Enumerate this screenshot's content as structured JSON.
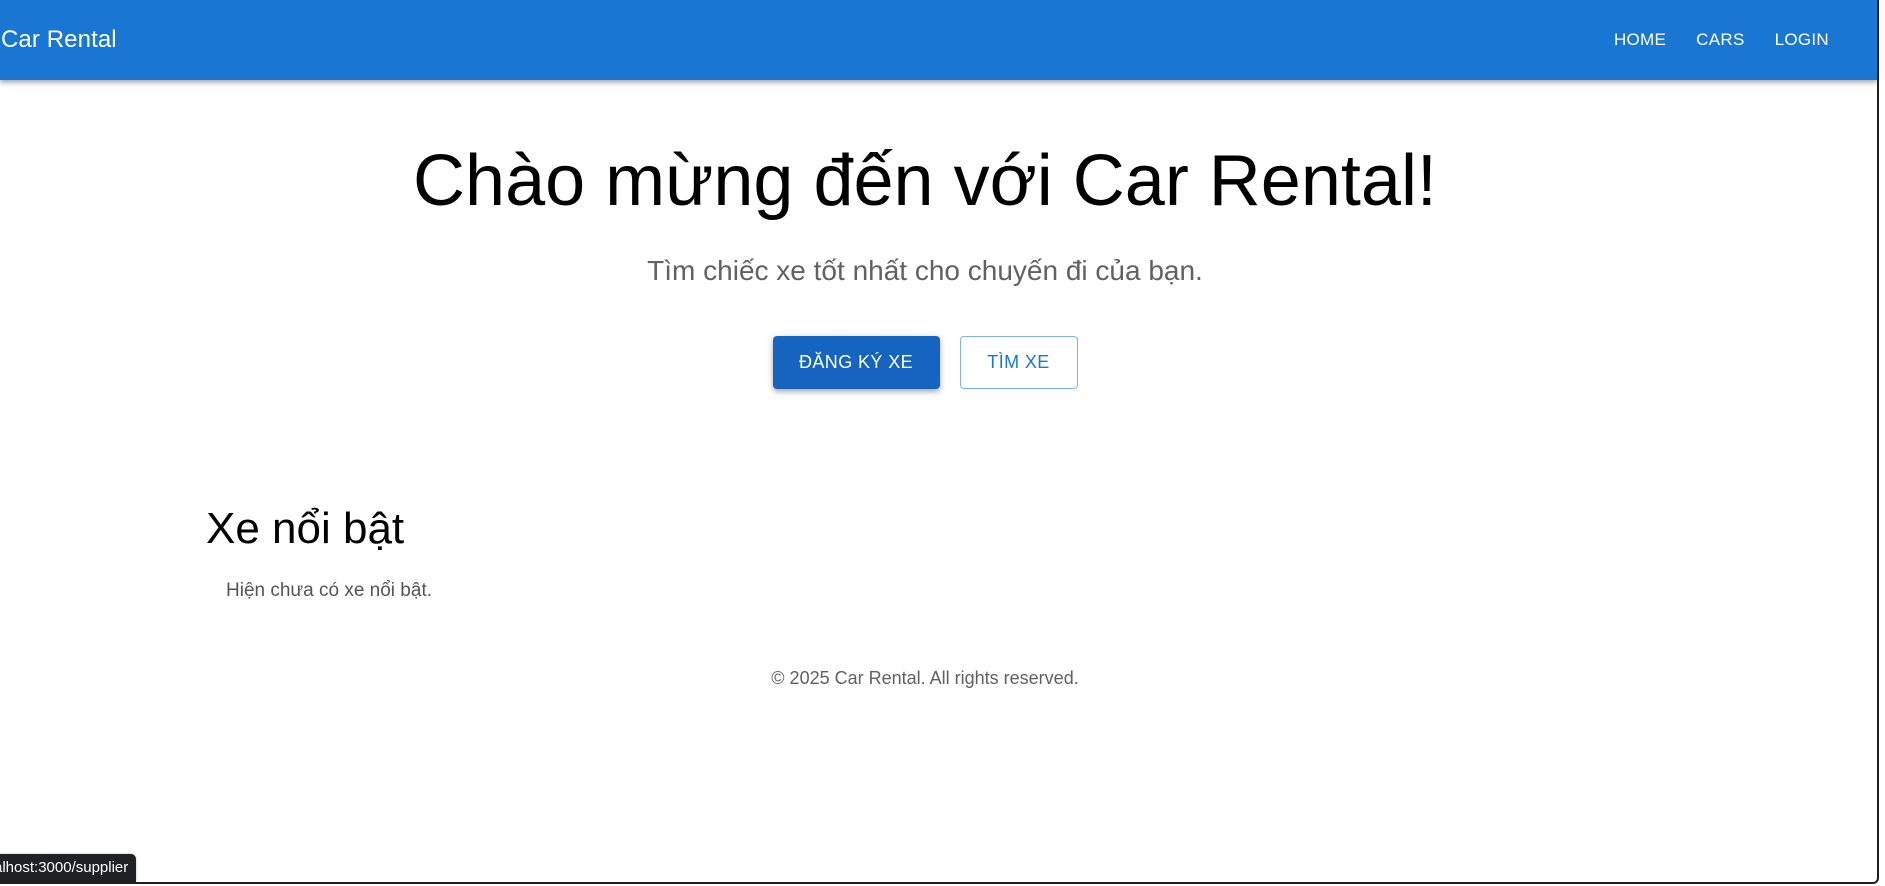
{
  "app": {
    "brand": "Car Rental",
    "theme_color": "#1976d2"
  },
  "nav": {
    "items": [
      {
        "label": "HOME"
      },
      {
        "label": "CARS"
      },
      {
        "label": "LOGIN"
      }
    ]
  },
  "hero": {
    "title": "Chào mừng đến với Car Rental!",
    "subtitle": "Tìm chiếc xe tốt nhất cho chuyến đi của bạn.",
    "primary_button": "ĐĂNG KÝ XE",
    "secondary_button": "TÌM XE"
  },
  "featured": {
    "heading": "Xe nổi bật",
    "empty_message": "Hiện chưa có xe nổi bật."
  },
  "footer": {
    "text": "© 2025 Car Rental. All rights reserved."
  },
  "status_bar": {
    "url": "alhost:3000/supplier"
  }
}
